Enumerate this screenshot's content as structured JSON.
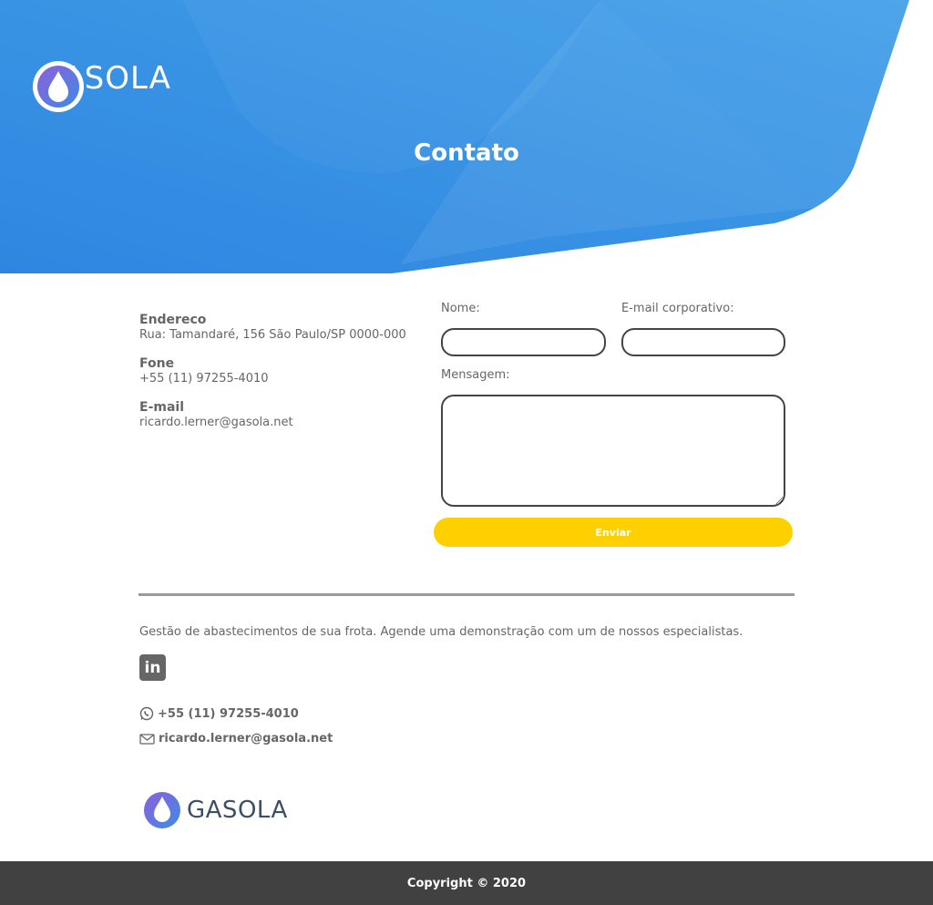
{
  "brand": {
    "name": "GASOLA",
    "primary_color": "#3a95e2",
    "accent_color": "#ffd000"
  },
  "hero": {
    "title": "Contato"
  },
  "contact": {
    "address_label": "Endereco",
    "address_value": "Rua: Tamandaré, 156 São Paulo/SP 0000-000",
    "phone_label": "Fone",
    "phone_value": "+55 (11) 97255-4010",
    "email_label": "E-mail",
    "email_value": "ricardo.lerner@gasola.net"
  },
  "form": {
    "name_label": "Nome:",
    "name_value": "",
    "email_label": "E-mail corporativo:",
    "email_value": "",
    "message_label": "Mensagem:",
    "message_value": "",
    "submit_label": "Enviar"
  },
  "footer": {
    "tagline": "Gestão de abastecimentos de sua frota. Agende uma demonstração com um de nossos especialistas.",
    "linkedin_icon": "linkedin-icon",
    "phone": "+55 (11) 97255-4010",
    "email": "ricardo.lerner@gasola.net",
    "copyright": "Copyright © 2020"
  }
}
